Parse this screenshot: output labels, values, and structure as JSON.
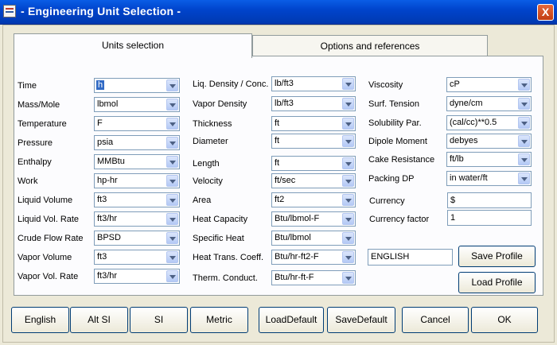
{
  "window": {
    "title": "- Engineering Unit Selection -",
    "close_label": "X"
  },
  "tabs": [
    {
      "label": "Units selection"
    },
    {
      "label": "Options and references"
    }
  ],
  "col1": [
    {
      "label": "Time",
      "value": "h"
    },
    {
      "label": "Mass/Mole",
      "value": "lbmol"
    },
    {
      "label": "Temperature",
      "value": "F"
    },
    {
      "label": "Pressure",
      "value": "psia"
    },
    {
      "label": "Enthalpy",
      "value": "MMBtu"
    },
    {
      "label": "Work",
      "value": "hp-hr"
    },
    {
      "label": "Liquid Volume",
      "value": "ft3"
    },
    {
      "label": "Liquid Vol. Rate",
      "value": "ft3/hr"
    },
    {
      "label": "Crude Flow Rate",
      "value": "BPSD"
    },
    {
      "label": "Vapor Volume",
      "value": "ft3"
    },
    {
      "label": "Vapor Vol. Rate",
      "value": "ft3/hr"
    }
  ],
  "col2": [
    {
      "label": "Liq. Density / Conc.",
      "value": "lb/ft3"
    },
    {
      "label": "Vapor Density",
      "value": "lb/ft3"
    },
    {
      "label": "Thickness",
      "value": "ft"
    },
    {
      "label": "Diameter",
      "value": "ft"
    },
    {
      "label": "Length",
      "value": "ft"
    },
    {
      "label": "Velocity",
      "value": "ft/sec"
    },
    {
      "label": "Area",
      "value": "ft2"
    },
    {
      "label": "Heat Capacity",
      "value": "Btu/lbmol-F"
    },
    {
      "label": "Specific Heat",
      "value": "Btu/lbmol"
    },
    {
      "label": "Heat Trans. Coeff.",
      "value": "Btu/hr-ft2-F"
    },
    {
      "label": "Therm. Conduct.",
      "value": "Btu/hr-ft-F"
    }
  ],
  "col3": [
    {
      "label": "Viscosity",
      "value": "cP"
    },
    {
      "label": "Surf. Tension",
      "value": "dyne/cm"
    },
    {
      "label": "Solubility Par.",
      "value": "(cal/cc)**0.5"
    },
    {
      "label": "Dipole Moment",
      "value": "debyes"
    },
    {
      "label": "Cake Resistance",
      "value": "ft/lb"
    },
    {
      "label": "Packing DP",
      "value": "in water/ft"
    }
  ],
  "currency": {
    "label": "Currency",
    "value": "$"
  },
  "currency_factor": {
    "label": "Currency factor",
    "value": "1"
  },
  "profile": {
    "name": "ENGLISH",
    "save_label": "Save Profile",
    "load_label": "Load Profile"
  },
  "footer": {
    "buttons": [
      "English",
      "Alt SI",
      "SI",
      "Metric",
      "LoadDefault",
      "SaveDefault",
      "Cancel",
      "OK"
    ]
  }
}
